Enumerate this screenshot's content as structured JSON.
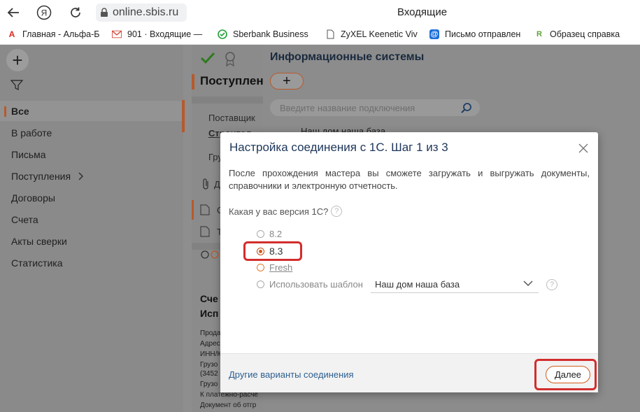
{
  "browser": {
    "url": "online.sbis.ru",
    "title": "Входящие",
    "bookmarks": [
      {
        "label": "Главная - Альфа-Б",
        "icon_color": "#e1251b",
        "icon": "A"
      },
      {
        "label": "901 · Входящие —",
        "icon_color": "#d44638",
        "icon": "M"
      },
      {
        "label": "Sberbank Business",
        "icon_color": "#21a038",
        "icon": "S"
      },
      {
        "label": "ZyXEL Keenetic Viv",
        "icon_color": "#555555",
        "icon": "doc"
      },
      {
        "label": "Письмо отправлен",
        "icon_color": "#1e6fd9",
        "icon": "@"
      },
      {
        "label": "Образец справка",
        "icon_color": "#5fa33a",
        "icon": "R"
      }
    ]
  },
  "sidebar": {
    "items": [
      {
        "label": "Все",
        "active": true
      },
      {
        "label": "В работе"
      },
      {
        "label": "Письма"
      },
      {
        "label": "Поступления",
        "has_chevron": true
      },
      {
        "label": "Договоры"
      },
      {
        "label": "Счета"
      },
      {
        "label": "Акты сверки"
      },
      {
        "label": "Статистика"
      }
    ]
  },
  "middle": {
    "header": "Поступлен",
    "supplier_label": "Поставщик",
    "supplier_value": "Строител",
    "group_label": "Гру",
    "attach_label": "Д",
    "doc1": "С",
    "doc2": "Т",
    "bold1": "Сче",
    "bold2": "Исп",
    "lines": [
      "Прода",
      "Адрес",
      "ИНН/К",
      "Грузо",
      "(3452",
      "Грузо",
      "К платежно-расче",
      "Документ об отгр"
    ]
  },
  "right": {
    "title": "Информационные системы",
    "search_placeholder": "Введите название подключения",
    "list_item": "Наш дом наша база"
  },
  "dialog": {
    "title": "Настройка соединения с 1С. Шаг 1 из 3",
    "description": "После прохождения мастера вы сможете загружать и выгружать документы, справочники и электронную отчетность.",
    "question": "Какая у вас версия 1С?",
    "options": [
      {
        "label": "8.2",
        "checked": false
      },
      {
        "label": "8.3",
        "checked": true
      },
      {
        "label": "Fresh",
        "checked": false
      },
      {
        "label": "Использовать шаблон",
        "checked": false
      }
    ],
    "template_value": "Наш дом наша база",
    "other_link": "Другие варианты соединения",
    "next_label": "Далее"
  }
}
